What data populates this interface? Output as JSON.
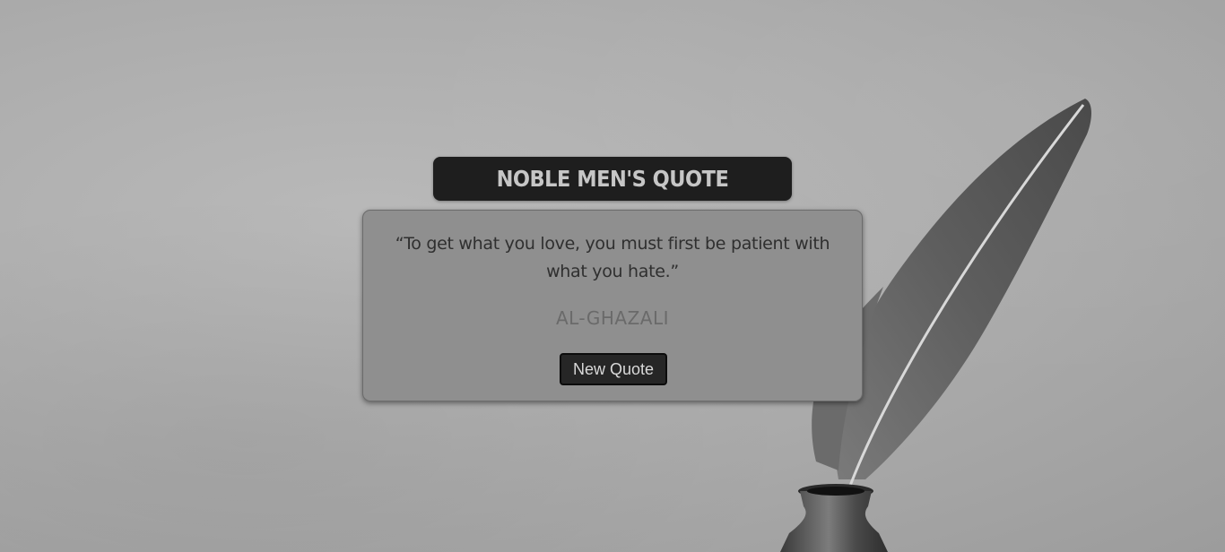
{
  "header": {
    "title": "NOBLE MEN'S QUOTE"
  },
  "quote": {
    "text": "“To get what you love, you must first be patient with what you hate.”",
    "author": "AL-GHAZALI"
  },
  "actions": {
    "new_quote_label": "New Quote"
  },
  "background": {
    "image": "feather-quill-inkwell"
  },
  "colors": {
    "title_bar": "#1e1e1e",
    "card": "#8f8f8f",
    "button": "#262626"
  }
}
